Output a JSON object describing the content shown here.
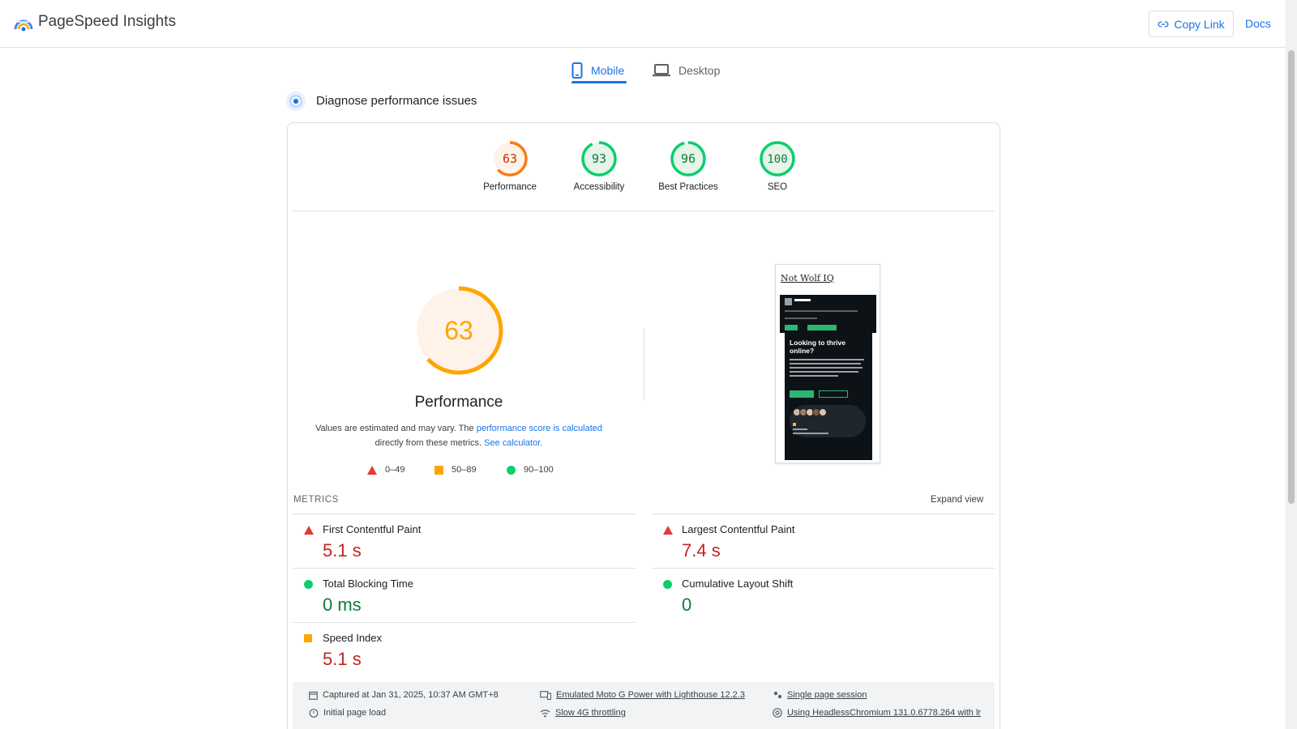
{
  "header": {
    "app_title": "PageSpeed Insights",
    "copy_link_label": "Copy Link",
    "docs_label": "Docs"
  },
  "tabs": [
    {
      "label": "Mobile",
      "active": true
    },
    {
      "label": "Desktop",
      "active": false
    }
  ],
  "section_title": "Diagnose performance issues",
  "categories": [
    {
      "score": "63",
      "label": "Performance",
      "color": "#fa7b17",
      "fill": "#fff3e9"
    },
    {
      "score": "93",
      "label": "Accessibility",
      "color": "#0cce6b",
      "fill": "#e6f4ea"
    },
    {
      "score": "96",
      "label": "Best Practices",
      "color": "#0cce6b",
      "fill": "#e6f4ea"
    },
    {
      "score": "100",
      "label": "SEO",
      "color": "#0cce6b",
      "fill": "#e6f4ea"
    }
  ],
  "performance": {
    "score": "63",
    "score_fraction": 0.63,
    "title": "Performance",
    "desc_prefix": "Values are estimated and may vary. The ",
    "desc_link1": "performance score is calculated",
    "desc_mid": " directly from these metrics. ",
    "desc_link2": "See calculator.",
    "legend": [
      {
        "range": "0–49",
        "shape": "triangle",
        "color": "#e53935"
      },
      {
        "range": "50–89",
        "shape": "square",
        "color": "#ffa400"
      },
      {
        "range": "90–100",
        "shape": "circle",
        "color": "#0cce6b"
      }
    ]
  },
  "screenshot": {
    "site_title": "Not Wolf IQ",
    "headline": "Looking to thrive online?"
  },
  "metrics": {
    "label": "METRICS",
    "expand_label": "Expand view",
    "items": [
      {
        "name": "First Contentful Paint",
        "value": "5.1 s",
        "status": "poor"
      },
      {
        "name": "Largest Contentful Paint",
        "value": "7.4 s",
        "status": "poor"
      },
      {
        "name": "Total Blocking Time",
        "value": "0 ms",
        "status": "good"
      },
      {
        "name": "Cumulative Layout Shift",
        "value": "0",
        "status": "good"
      },
      {
        "name": "Speed Index",
        "value": "5.1 s",
        "status": "average"
      }
    ]
  },
  "run_info": {
    "captured": "Captured at Jan 31, 2025, 10:37 AM GMT+8",
    "device": "Emulated Moto G Power with Lighthouse 12.2.3",
    "session": "Single page session",
    "load": "Initial page load",
    "throttling": "Slow 4G throttling",
    "browser": "Using HeadlessChromium 131.0.6778.264 with lr"
  }
}
